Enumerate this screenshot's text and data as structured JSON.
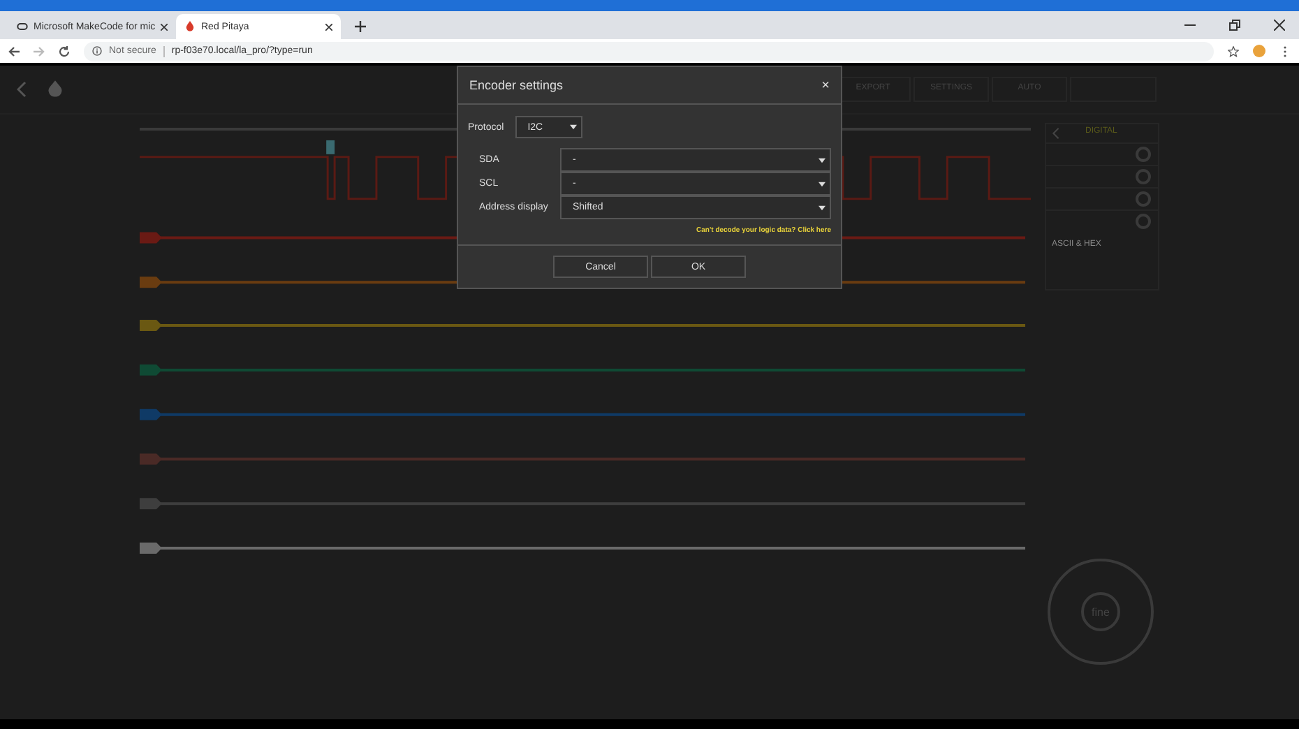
{
  "browser": {
    "tabs": [
      {
        "title": "Microsoft MakeCode for mic",
        "selected": false
      },
      {
        "title": "Red Pitaya",
        "selected": true
      }
    ],
    "address": {
      "security": "Not secure",
      "url": "rp-f03e70.local/la_pro/?type=run"
    }
  },
  "app": {
    "nav": [
      "EXPORT",
      "SETTINGS",
      "AUTO"
    ],
    "channels": [
      {
        "color": "#6a1a14"
      },
      {
        "color": "#6a3c10"
      },
      {
        "color": "#6a5812"
      },
      {
        "color": "#0f4a34"
      },
      {
        "color": "#0f3a66"
      },
      {
        "color": "#4a2a26"
      },
      {
        "color": "#3e3e3e"
      },
      {
        "color": "#6a6a6a"
      }
    ],
    "panel": {
      "title": "DIGITAL",
      "display": "ASCII & HEX"
    },
    "dial": {
      "center": "fine"
    }
  },
  "dialog": {
    "title": "Encoder settings",
    "close": "×",
    "protocol": {
      "label": "Protocol",
      "value": "I2C"
    },
    "fields": [
      {
        "label": "SDA",
        "value": "-"
      },
      {
        "label": "SCL",
        "value": "-"
      },
      {
        "label": "Address display",
        "value": "Shifted"
      }
    ],
    "help_link": "Can't decode your logic data? Click here",
    "buttons": [
      "Cancel",
      "OK"
    ]
  }
}
